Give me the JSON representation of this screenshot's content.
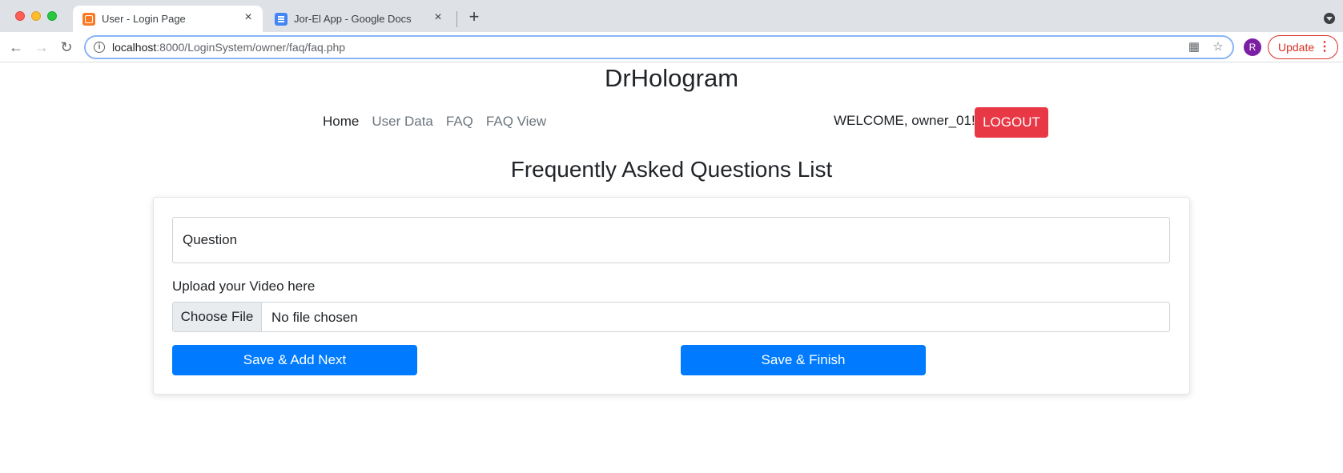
{
  "browser": {
    "tabs": [
      {
        "title": "User - Login Page",
        "favicon": "xampp-icon",
        "active": true
      },
      {
        "title": "Jor-El App - Google Docs",
        "favicon": "google-docs-icon",
        "active": false
      }
    ],
    "url_host": "localhost",
    "url_path": ":8000/LoginSystem/owner/faq/faq.php",
    "profile_initial": "R",
    "update_label": "Update"
  },
  "page": {
    "brand": "DrHologram",
    "nav": {
      "home": "Home",
      "user_data": "User Data",
      "faq": "FAQ",
      "faq_view": "FAQ View"
    },
    "welcome": "WELCOME, owner_01! -",
    "logout_label": "LOGOUT",
    "title": "Frequently Asked Questions List",
    "form": {
      "question_placeholder": "Question",
      "upload_label": "Upload your Video here",
      "choose_file_label": "Choose File",
      "no_file_text": "No file chosen",
      "save_next_label": "Save & Add Next",
      "save_finish_label": "Save & Finish"
    }
  },
  "colors": {
    "primary": "#007bff",
    "danger": "#e83745"
  }
}
